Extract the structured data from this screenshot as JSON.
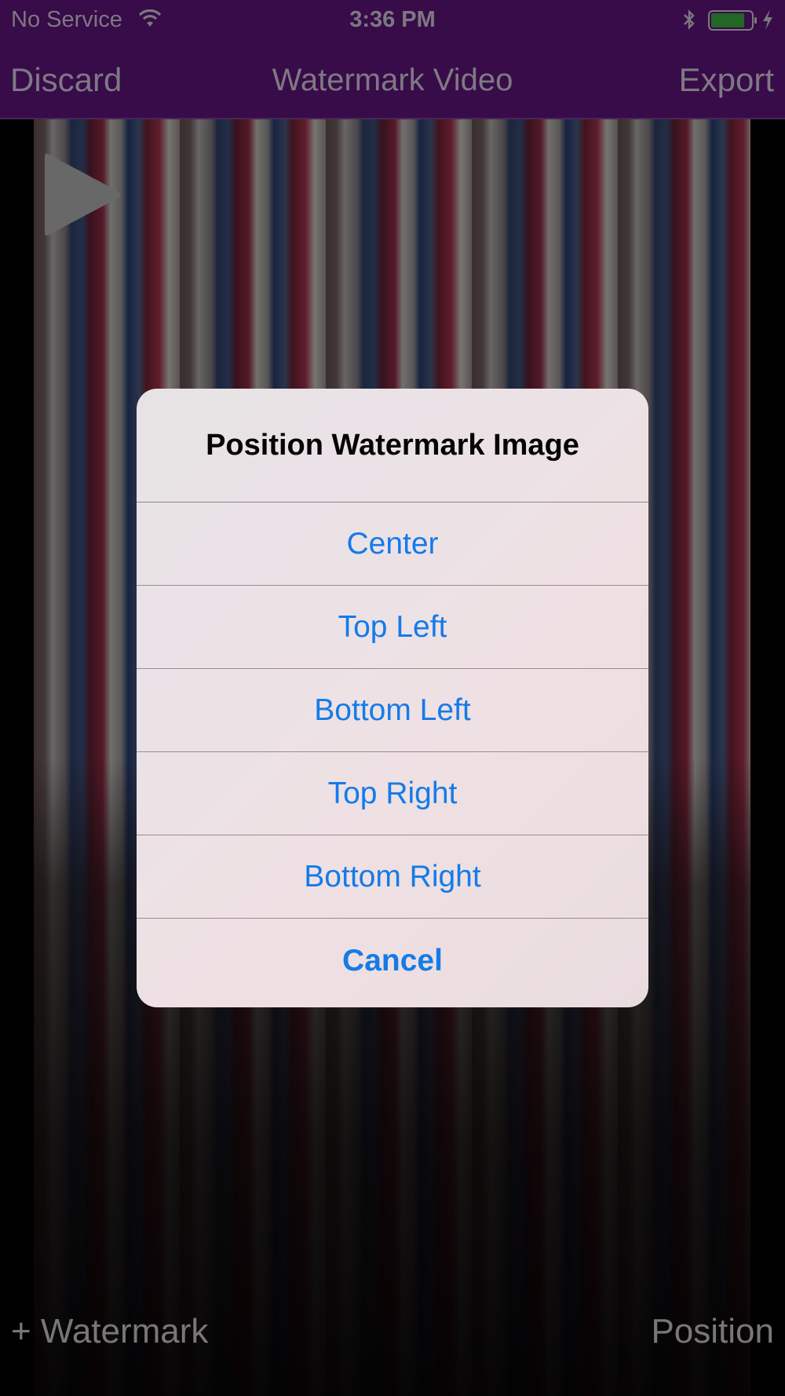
{
  "status_bar": {
    "carrier": "No Service",
    "time": "3:36 PM",
    "icons": [
      "wifi-icon",
      "bluetooth-icon",
      "battery-icon",
      "charging-icon"
    ]
  },
  "nav": {
    "left_label": "Discard",
    "title": "Watermark Video",
    "right_label": "Export"
  },
  "video": {
    "play_icon": "play-icon"
  },
  "bottom": {
    "left_label": "+ Watermark",
    "right_label": "Position"
  },
  "alert": {
    "title": "Position Watermark Image",
    "options": [
      "Center",
      "Top Left",
      "Bottom Left",
      "Top Right",
      "Bottom Right"
    ],
    "cancel_label": "Cancel"
  },
  "colors": {
    "nav_bar": "#5b1277",
    "action_blue": "#147be9",
    "battery_green": "#3aa53a"
  }
}
